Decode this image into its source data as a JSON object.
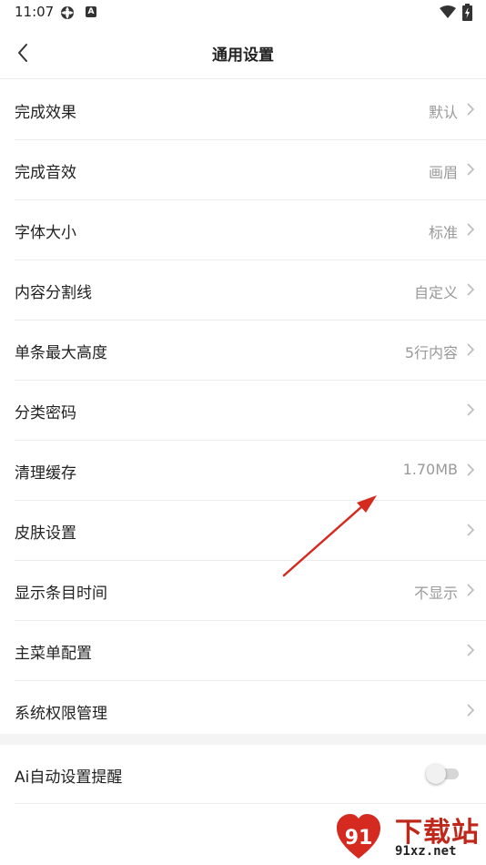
{
  "status_bar": {
    "time": "11:07",
    "a_badge": "A"
  },
  "header": {
    "title": "通用设置",
    "back_icon": "chevron-left-icon"
  },
  "settings": [
    {
      "label": "完成效果",
      "value": "默认"
    },
    {
      "label": "完成音效",
      "value": "画眉"
    },
    {
      "label": "字体大小",
      "value": "标准"
    },
    {
      "label": "内容分割线",
      "value": "自定义"
    },
    {
      "label": "单条最大高度",
      "value": "5行内容"
    },
    {
      "label": "分类密码",
      "value": ""
    },
    {
      "label": "清理缓存",
      "value": "1.70MB"
    },
    {
      "label": "皮肤设置",
      "value": ""
    },
    {
      "label": "显示条目时间",
      "value": "不显示"
    },
    {
      "label": "主菜单配置",
      "value": ""
    },
    {
      "label": "系统权限管理",
      "value": ""
    }
  ],
  "toggle_setting": {
    "label": "Ai自动设置提醒",
    "enabled": false
  },
  "watermark": {
    "title": "下载站",
    "url": "91xz.net",
    "logo_text": "91"
  },
  "colors": {
    "accent_arrow": "#d42a20",
    "value_gray": "#999999",
    "divider": "#ececec"
  }
}
